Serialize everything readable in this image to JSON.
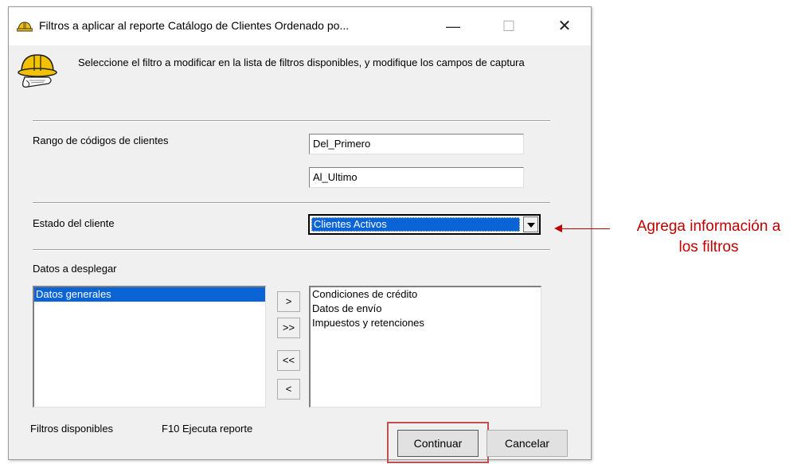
{
  "window": {
    "title": "Filtros a aplicar al reporte Catálogo de Clientes Ordenado po...",
    "minimize_glyph": "—",
    "maximize_glyph": "☐",
    "close_glyph": "✕",
    "icon": "hardhat-icon"
  },
  "header": {
    "icon": "hardhat-scroll-icon",
    "instructions": "Seleccione el filtro a modificar  en la lista de filtros disponibles, y modifique los campos de  captura"
  },
  "filters": {
    "range": {
      "label": "Rango de códigos de clientes",
      "from_value": "Del_Primero",
      "to_value": "Al_Ultimo"
    },
    "status": {
      "label": "Estado del cliente",
      "selected": "Clientes Activos"
    },
    "display": {
      "label": "Datos a desplegar",
      "available": [
        "Datos generales"
      ],
      "selected": [
        "Condiciones de crédito",
        "Datos de envío",
        "Impuestos y retenciones"
      ],
      "move_buttons": [
        ">",
        ">>",
        "<<",
        "<"
      ]
    }
  },
  "footer": {
    "left_label": "Filtros disponibles",
    "shortcut_label": "F10 Ejecuta reporte",
    "continue_label": "Continuar",
    "cancel_label": "Cancelar"
  },
  "annotation": {
    "text_line1": "Agrega información a",
    "text_line2": "los filtros",
    "color": "#c00000"
  },
  "colors": {
    "selection": "#0a64d6",
    "highlight_box": "#c0504d"
  }
}
